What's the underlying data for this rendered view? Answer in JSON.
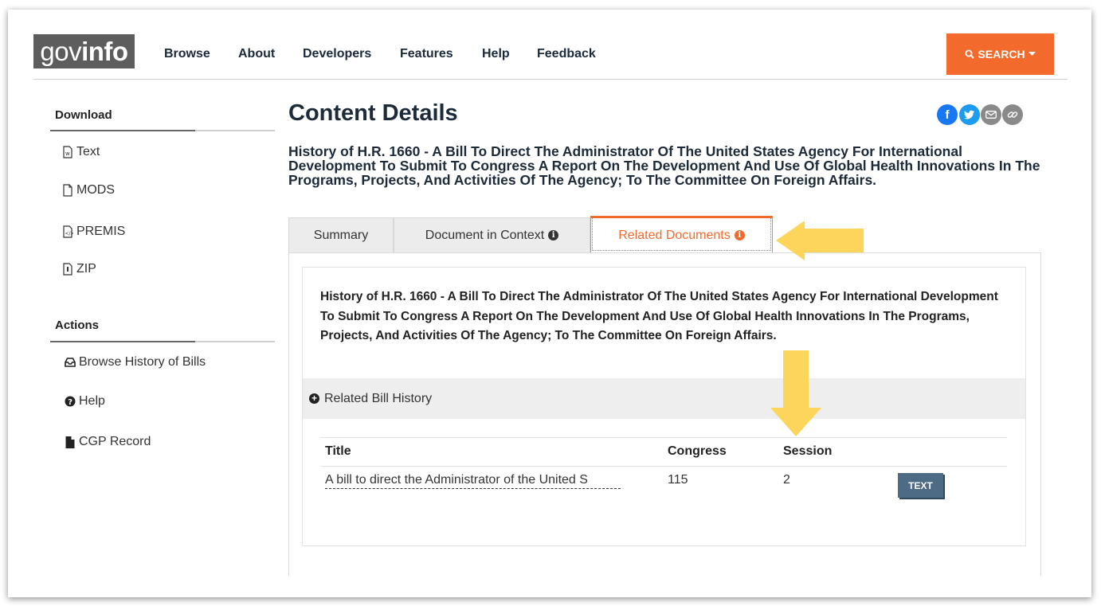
{
  "header": {
    "logo_prefix": "gov",
    "logo_suffix": "info",
    "nav": [
      "Browse",
      "About",
      "Developers",
      "Features",
      "Help",
      "Feedback"
    ],
    "search_label": "SEARCH",
    "accent_color": "#f26b2d"
  },
  "sidebar": {
    "download_heading": "Download",
    "downloads": [
      {
        "label": "Text",
        "icon": "word-file-icon"
      },
      {
        "label": "MODS",
        "icon": "file-icon"
      },
      {
        "label": "PREMIS",
        "icon": "code-file-icon"
      },
      {
        "label": "ZIP",
        "icon": "zip-file-icon"
      }
    ],
    "actions_heading": "Actions",
    "actions": [
      {
        "label": "Browse History of Bills",
        "icon": "inbox-icon"
      },
      {
        "label": "Help",
        "icon": "question-circle-icon"
      },
      {
        "label": "CGP Record",
        "icon": "document-icon"
      }
    ]
  },
  "main": {
    "title": "Content Details",
    "subtitle": "History of H.R. 1660 - A Bill To Direct The Administrator Of The United States Agency For International Development To Submit To Congress A Report On The Development And Use Of Global Health Innovations In The Programs, Projects, And Activities Of The Agency; To The Committee On Foreign Affairs.",
    "tabs": [
      {
        "label": "Summary"
      },
      {
        "label": "Document in Context"
      },
      {
        "label": "Related Documents"
      }
    ],
    "active_tab": "Related Documents",
    "card_text": "History of H.R. 1660 - A Bill To Direct The Administrator Of The United States Agency For International Development To Submit To Congress A Report On The Development And Use Of Global Health Innovations In The Programs, Projects, And Activities Of The Agency; To The Committee On Foreign Affairs.",
    "accordion_label": "Related Bill History",
    "table": {
      "headers": [
        "Title",
        "Congress",
        "Session"
      ],
      "rows": [
        {
          "title": "A bill to direct the Administrator of the United S",
          "congress": "115",
          "session": "2",
          "button": "TEXT"
        }
      ]
    },
    "social_icons": [
      "facebook-icon",
      "twitter-icon",
      "email-icon",
      "link-icon"
    ]
  },
  "annotations": {
    "arrow_color": "#fdd55a"
  }
}
